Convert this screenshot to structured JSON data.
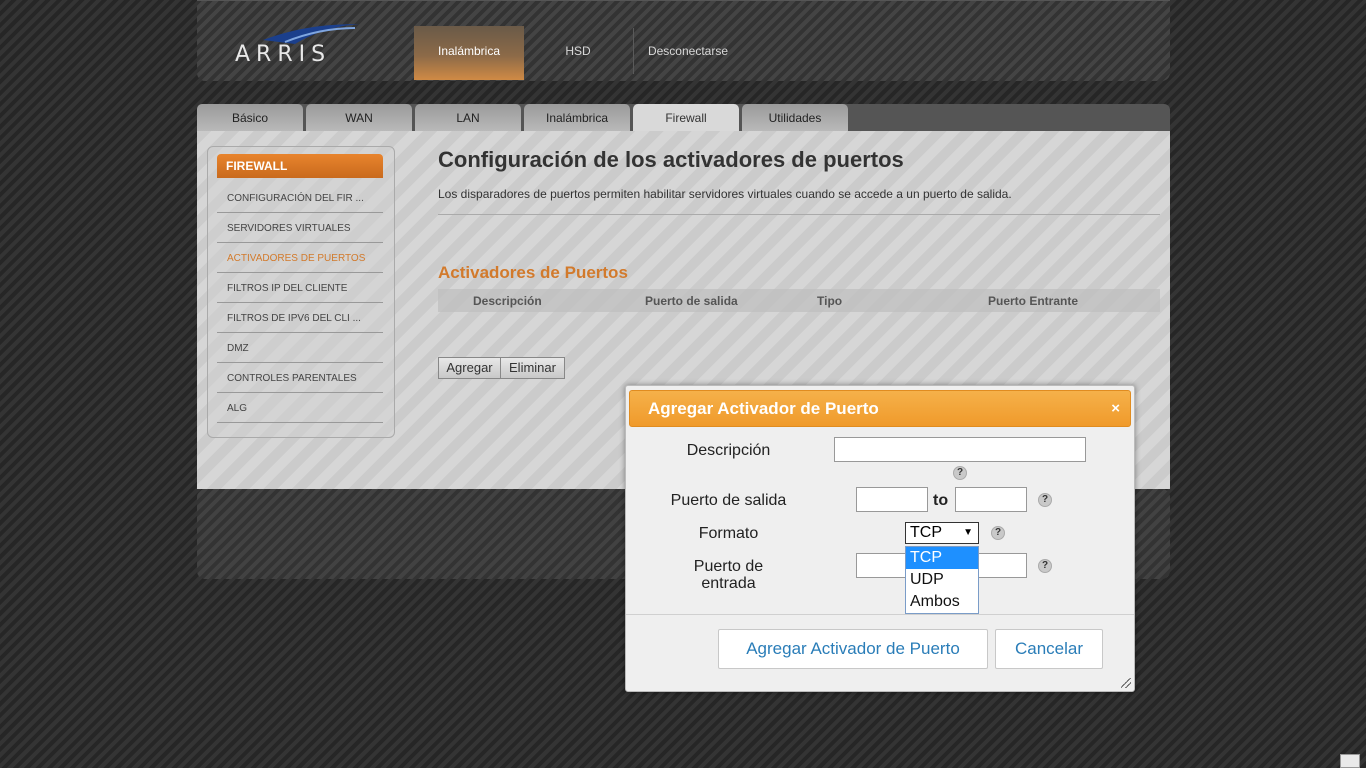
{
  "header": {
    "logo_text": "ARRIS",
    "nav": [
      {
        "label": "Inalámbrica",
        "active": true
      },
      {
        "label": "HSD",
        "active": false
      },
      {
        "label": "Desconectarse",
        "active": false
      }
    ]
  },
  "tabs": [
    {
      "label": "Básico"
    },
    {
      "label": "WAN"
    },
    {
      "label": "LAN"
    },
    {
      "label": "Inalámbrica"
    },
    {
      "label": "Firewall",
      "active": true
    },
    {
      "label": "Utilidades"
    }
  ],
  "sidebar": {
    "title": "FIREWALL",
    "items": [
      {
        "label": "CONFIGURACIÓN DEL FIR ..."
      },
      {
        "label": "SERVIDORES VIRTUALES"
      },
      {
        "label": "ACTIVADORES DE PUERTOS",
        "active": true
      },
      {
        "label": "FILTROS IP DEL CLIENTE"
      },
      {
        "label": "FILTROS DE IPV6 DEL CLI ..."
      },
      {
        "label": "DMZ"
      },
      {
        "label": "CONTROLES PARENTALES"
      },
      {
        "label": "ALG"
      }
    ]
  },
  "main": {
    "title": "Configuración de los activadores de puertos",
    "description": "Los disparadores de puertos permiten habilitar servidores virtuales cuando se accede a un puerto de salida.",
    "section_title": "Activadores de Puertos",
    "table_headers": [
      "Descripción",
      "Puerto de salida",
      "Tipo",
      "Puerto Entrante"
    ],
    "add_label": "Agregar",
    "delete_label": "Eliminar"
  },
  "dialog": {
    "title": "Agregar Activador de Puerto",
    "close_symbol": "×",
    "description_label": "Descripción",
    "description_value": "",
    "outbound_label": "Puerto de salida",
    "to_label": "to",
    "format_label": "Formato",
    "format_selected": "TCP",
    "format_options": [
      "TCP",
      "UDP",
      "Ambos"
    ],
    "inbound_label_line1": "Puerto de",
    "inbound_label_line2": "entrada",
    "help_symbol": "?",
    "submit_label": "Agregar Activador de Puerto",
    "cancel_label": "Cancelar"
  },
  "colors": {
    "accent_orange": "#d27a2c",
    "dialog_header": "#f5a93a",
    "link_blue": "#2a7db8",
    "selected_option": "#1e90ff"
  }
}
